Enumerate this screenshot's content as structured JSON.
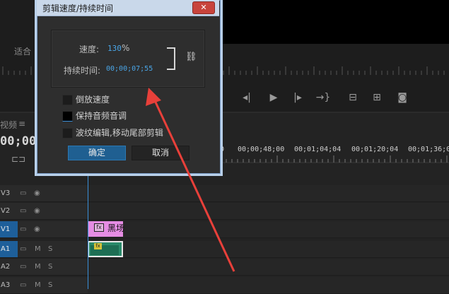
{
  "dialog": {
    "title": "剪辑速度/持续时间",
    "close_icon": "close-icon",
    "speed_label": "速度:",
    "speed_value": "130",
    "speed_unit": "%",
    "duration_label": "持续时间:",
    "duration_value": "00;00;07;55",
    "link_icon": "chain-link-icon",
    "checkboxes": [
      {
        "label": "倒放速度",
        "checked": false
      },
      {
        "label": "保持音频音调",
        "checked": true
      },
      {
        "label": "波纹编辑,移动尾部剪辑",
        "checked": false
      }
    ],
    "ok_label": "确定",
    "cancel_label": "取消"
  },
  "monitor": {
    "fit_label": "适合",
    "controls": [
      "step-back-icon",
      "play-icon",
      "step-forward-icon",
      "go-to-out-icon",
      "lift-icon",
      "extract-icon",
      "export-frame-icon"
    ]
  },
  "timeline": {
    "sequence_label": "视频",
    "menu_icon": "≡",
    "timecode": "00;00",
    "ruler_labels": [
      "0",
      "00;00;48;00",
      "00;01;04;04",
      "00;01;20;04",
      "00;01;36;0"
    ],
    "tracks": [
      {
        "id": "V3",
        "type": "video",
        "active": false
      },
      {
        "id": "V2",
        "type": "video",
        "active": false
      },
      {
        "id": "V1",
        "type": "video",
        "active": true
      },
      {
        "id": "A1",
        "type": "audio",
        "active": true
      },
      {
        "id": "A2",
        "type": "audio",
        "active": false
      },
      {
        "id": "A3",
        "type": "audio",
        "active": false
      }
    ],
    "clip_v1_label": "黑场",
    "fx_label": "fx",
    "mute_label": "M",
    "solo_label": "S"
  },
  "annotation": {
    "arrow_color": "#e8403a"
  }
}
